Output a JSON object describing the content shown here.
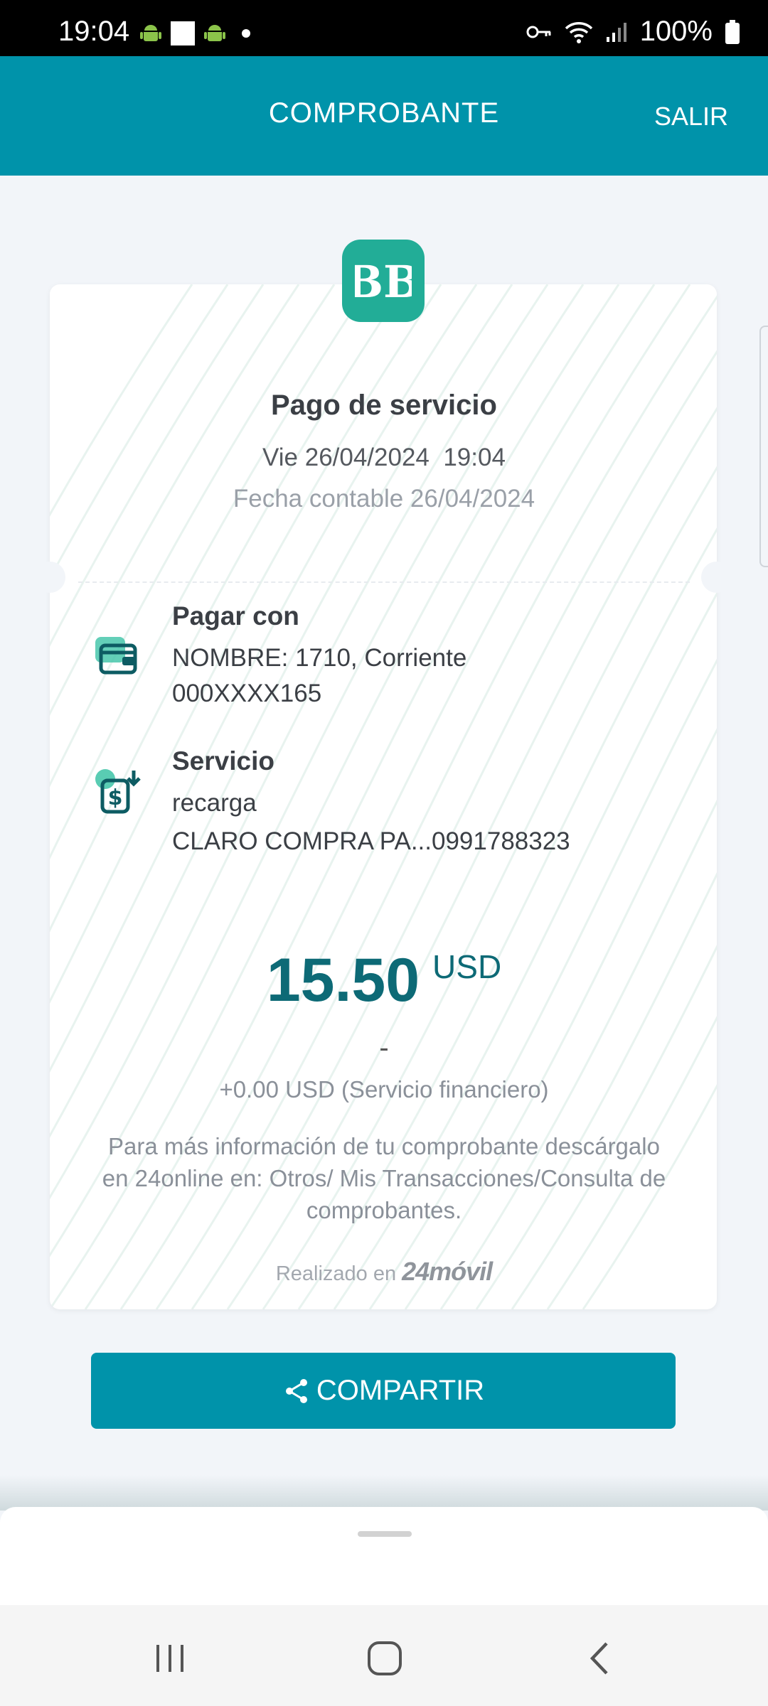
{
  "status_bar": {
    "time": "19:04",
    "battery": "100%",
    "icons": [
      "android-icon",
      "square-icon",
      "android-icon",
      "dot-icon",
      "key-icon",
      "wifi-icon",
      "signal-icon",
      "battery-icon"
    ]
  },
  "header": {
    "title": "COMPROBANTE",
    "exit_label": "SALIR"
  },
  "receipt": {
    "logo_text": "BB",
    "title": "Pago de servicio",
    "datetime": "Vie 26/04/2024  19:04",
    "accounting_date": "Fecha contable 26/04/2024",
    "pay_with": {
      "label": "Pagar con",
      "line1": "NOMBRE: 1710, Corriente",
      "line2": "000XXXX165",
      "icon": "wallet-icon"
    },
    "service": {
      "label": "Servicio",
      "line1": "recarga",
      "line2": "CLARO COMPRA PA...0991788323",
      "icon": "dollar-download-icon"
    },
    "amount": "15.50",
    "currency": "USD",
    "dash": "-",
    "fee": "+0.00 USD (Servicio financiero)",
    "info": "Para más información de tu comprobante descárgalo en 24online en: Otros/ Mis Transacciones/Consulta de comprobantes.",
    "realized_label": "Realizado en",
    "realized_brand": "24móvil"
  },
  "share_button": {
    "label": "COMPARTIR",
    "icon": "share-icon"
  },
  "colors": {
    "primary": "#0093aa",
    "amount": "#0d6a76",
    "logo": "#22ad97"
  },
  "nav": {
    "icons": [
      "recents-icon",
      "home-icon",
      "back-icon"
    ]
  }
}
